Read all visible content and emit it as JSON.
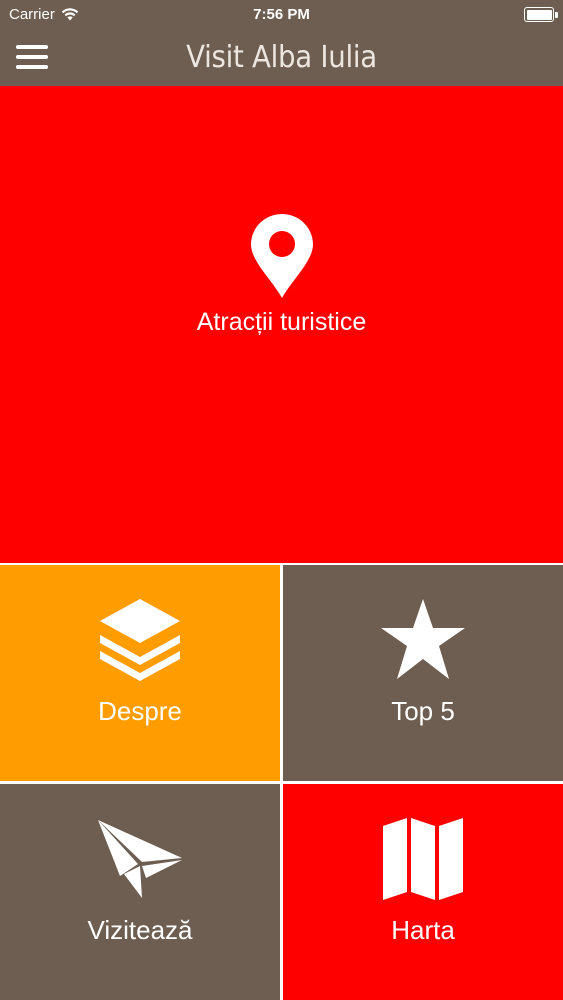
{
  "status_bar": {
    "carrier": "Carrier",
    "time": "7:56 PM"
  },
  "nav": {
    "title": "Visit Alba Iulia",
    "menu_icon": "hamburger-menu-icon"
  },
  "tiles": {
    "attractions": {
      "label": "Atracții turistice",
      "icon": "map-pin-icon",
      "color": "#ff0000"
    },
    "despre": {
      "label": "Despre",
      "icon": "layers-icon",
      "color": "#ff9c00"
    },
    "top5": {
      "label": "Top 5",
      "icon": "star-icon",
      "color": "#6e5e51"
    },
    "viziteaza": {
      "label": "Vizitează",
      "icon": "paper-plane-icon",
      "color": "#6e5e51"
    },
    "harta": {
      "label": "Harta",
      "icon": "map-icon",
      "color": "#ff0000"
    }
  },
  "colors": {
    "bar_background": "#6e5e51",
    "divider": "#ffffff"
  }
}
